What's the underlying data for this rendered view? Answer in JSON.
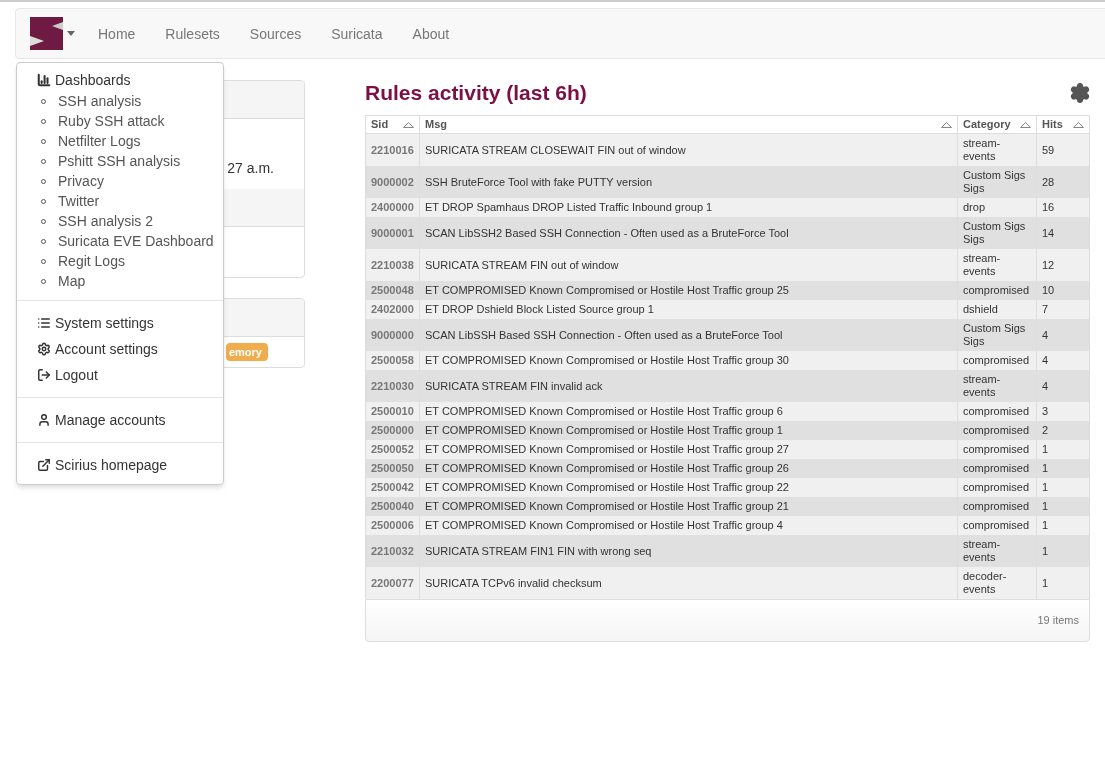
{
  "navbar": {
    "items": [
      {
        "label": "Home"
      },
      {
        "label": "Rulesets"
      },
      {
        "label": "Sources"
      },
      {
        "label": "Suricata"
      },
      {
        "label": "About"
      }
    ]
  },
  "menu": {
    "dashboards_title": "Dashboards",
    "dashboards": [
      "SSH analysis",
      "Ruby SSH attack",
      "Netfilter Logs",
      "Pshitt SSH analysis",
      "Privacy",
      "Twitter",
      "SSH analysis 2",
      "Suricata EVE Dashboard",
      "Regit Logs",
      "Map"
    ],
    "groups": [
      [
        {
          "label": "System settings",
          "kind": "list"
        },
        {
          "label": "Account settings",
          "kind": "gear"
        },
        {
          "label": "Logout",
          "kind": "logout"
        }
      ],
      [
        {
          "label": "Manage accounts",
          "kind": "user"
        }
      ],
      [
        {
          "label": "Scirius homepage",
          "kind": "external"
        }
      ]
    ]
  },
  "background_panels": {
    "time_text": "27 a.m.",
    "badge": "emory"
  },
  "rules": {
    "title": "Rules activity (last 6h)",
    "columns": [
      "Sid",
      "Msg",
      "Category",
      "Hits"
    ],
    "rows": [
      {
        "sid": "2210016",
        "msg": "SURICATA STREAM CLOSEWAIT FIN out of window",
        "category": "stream-events",
        "hits": "59"
      },
      {
        "sid": "9000002",
        "msg": "SSH BruteForce Tool with fake PUTTY version",
        "category": "Custom Sigs Sigs",
        "hits": "28"
      },
      {
        "sid": "2400000",
        "msg": "ET DROP Spamhaus DROP Listed Traffic Inbound group 1",
        "category": "drop",
        "hits": "16"
      },
      {
        "sid": "9000001",
        "msg": "SCAN LibSSH2 Based SSH Connection - Often used as a BruteForce Tool",
        "category": "Custom Sigs Sigs",
        "hits": "14"
      },
      {
        "sid": "2210038",
        "msg": "SURICATA STREAM FIN out of window",
        "category": "stream-events",
        "hits": "12"
      },
      {
        "sid": "2500048",
        "msg": "ET COMPROMISED Known Compromised or Hostile Host Traffic group 25",
        "category": "compromised",
        "hits": "10"
      },
      {
        "sid": "2402000",
        "msg": "ET DROP Dshield Block Listed Source group 1",
        "category": "dshield",
        "hits": "7"
      },
      {
        "sid": "9000000",
        "msg": "SCAN LibSSH Based SSH Connection - Often used as a BruteForce Tool",
        "category": "Custom Sigs Sigs",
        "hits": "4"
      },
      {
        "sid": "2500058",
        "msg": "ET COMPROMISED Known Compromised or Hostile Host Traffic group 30",
        "category": "compromised",
        "hits": "4"
      },
      {
        "sid": "2210030",
        "msg": "SURICATA STREAM FIN invalid ack",
        "category": "stream-events",
        "hits": "4"
      },
      {
        "sid": "2500010",
        "msg": "ET COMPROMISED Known Compromised or Hostile Host Traffic group 6",
        "category": "compromised",
        "hits": "3"
      },
      {
        "sid": "2500000",
        "msg": "ET COMPROMISED Known Compromised or Hostile Host Traffic group 1",
        "category": "compromised",
        "hits": "2"
      },
      {
        "sid": "2500052",
        "msg": "ET COMPROMISED Known Compromised or Hostile Host Traffic group 27",
        "category": "compromised",
        "hits": "1"
      },
      {
        "sid": "2500050",
        "msg": "ET COMPROMISED Known Compromised or Hostile Host Traffic group 26",
        "category": "compromised",
        "hits": "1"
      },
      {
        "sid": "2500042",
        "msg": "ET COMPROMISED Known Compromised or Hostile Host Traffic group 22",
        "category": "compromised",
        "hits": "1"
      },
      {
        "sid": "2500040",
        "msg": "ET COMPROMISED Known Compromised or Hostile Host Traffic group 21",
        "category": "compromised",
        "hits": "1"
      },
      {
        "sid": "2500006",
        "msg": "ET COMPROMISED Known Compromised or Hostile Host Traffic group 4",
        "category": "compromised",
        "hits": "1"
      },
      {
        "sid": "2210032",
        "msg": "SURICATA STREAM FIN1 FIN with wrong seq",
        "category": "stream-events",
        "hits": "1"
      },
      {
        "sid": "2200077",
        "msg": "SURICATA TCPv6 invalid checksum",
        "category": "decoder-events",
        "hits": "1"
      }
    ],
    "footer": "19 items"
  }
}
